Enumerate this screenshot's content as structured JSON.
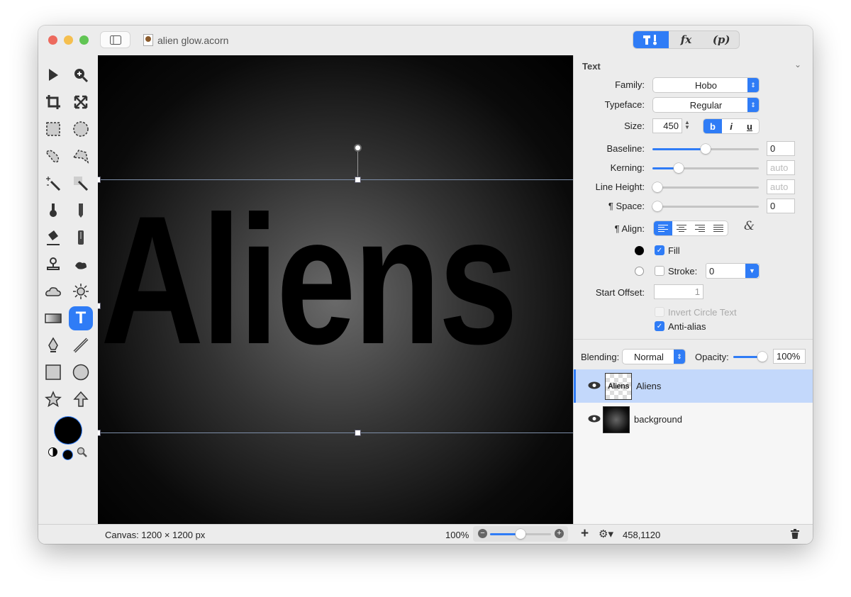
{
  "window": {
    "title": "alien glow.acorn"
  },
  "toolbar_segments": [
    {
      "label": "hammer-brush",
      "icon": "tools-icon",
      "active": true
    },
    {
      "label": "fx"
    },
    {
      "label": "(p)"
    }
  ],
  "text_panel": {
    "title": "Text",
    "family_label": "Family:",
    "family": "Hobo",
    "typeface_label": "Typeface:",
    "typeface": "Regular",
    "size_label": "Size:",
    "size": "450",
    "style_buttons": [
      "b",
      "i",
      "u"
    ],
    "baseline_label": "Baseline:",
    "baseline": "0",
    "baseline_slider": 0.5,
    "kerning_label": "Kerning:",
    "kerning_placeholder": "auto",
    "kerning_slider": 0.22,
    "line_height_label": "Line Height:",
    "line_height_placeholder": "auto",
    "line_height_slider": 0,
    "space_label": "¶ Space:",
    "space": "0",
    "space_slider": 0,
    "align_label": "¶ Align:",
    "align_selected": "left",
    "ligature_icon": "&",
    "fill_label": "Fill",
    "fill_checked": true,
    "fill_color": "#000000",
    "stroke_label": "Stroke:",
    "stroke_checked": false,
    "stroke_width": "0",
    "stroke_color": "#ffffff",
    "start_offset_label": "Start Offset:",
    "start_offset": "1",
    "invert_label": "Invert Circle Text",
    "invert_checked": false,
    "antialias_label": "Anti-alias",
    "antialias_checked": true
  },
  "layers_panel": {
    "blending_label": "Blending:",
    "blending": "Normal",
    "opacity_label": "Opacity:",
    "opacity": "100%",
    "opacity_slider": 1.0,
    "layers": [
      {
        "name": "Aliens",
        "thumb_text": "Aliens",
        "selected": true
      },
      {
        "name": "background",
        "selected": false
      }
    ]
  },
  "canvas": {
    "text": "Aliens"
  },
  "status": {
    "canvas_size": "Canvas: 1200 × 1200 px",
    "zoom": "100%",
    "zoom_slider": 0.5,
    "coordinates": "458,1120"
  },
  "colors": {
    "accent": "#2f7cf6",
    "selection": "#c3d8fb",
    "foreground": "#000000"
  }
}
